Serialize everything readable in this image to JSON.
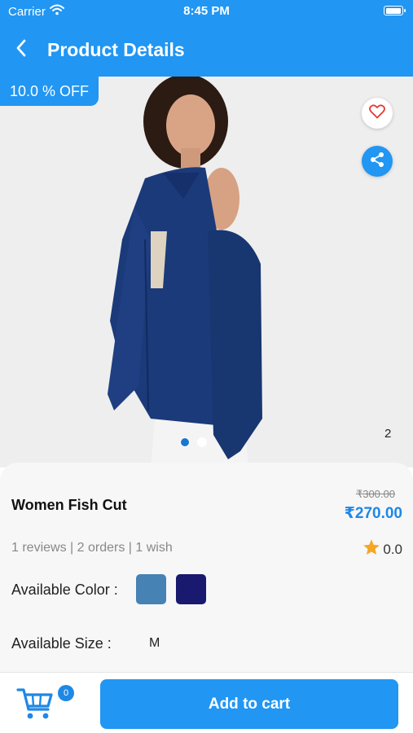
{
  "status_bar": {
    "carrier": "Carrier",
    "time": "8:45 PM"
  },
  "header": {
    "title": "Product Details"
  },
  "image": {
    "discount": "10.0 % OFF",
    "count": "2",
    "dots": {
      "total": 2,
      "active": 0
    }
  },
  "product": {
    "name": "Women Fish Cut",
    "old_price": "₹300.00",
    "new_price": "₹270.00",
    "stats": "1 reviews | 2 orders | 1 wish",
    "rating": "0.0",
    "color_label": "Available Color :",
    "colors": [
      "#4682b4",
      "#191970"
    ],
    "size_label": "Available Size :",
    "size_value": "M"
  },
  "bottom": {
    "cart_count": "0",
    "add_to_cart": "Add to cart"
  },
  "icons": {
    "back": "chevron-left-icon",
    "wifi": "wifi-icon",
    "battery": "battery-icon",
    "wish": "heart-icon",
    "share": "share-icon",
    "star": "star-icon",
    "cart": "cart-icon"
  },
  "colors": {
    "accent": "#2196f3",
    "price": "#1e88e5",
    "star": "#f5a623",
    "heart": "#e53935"
  }
}
